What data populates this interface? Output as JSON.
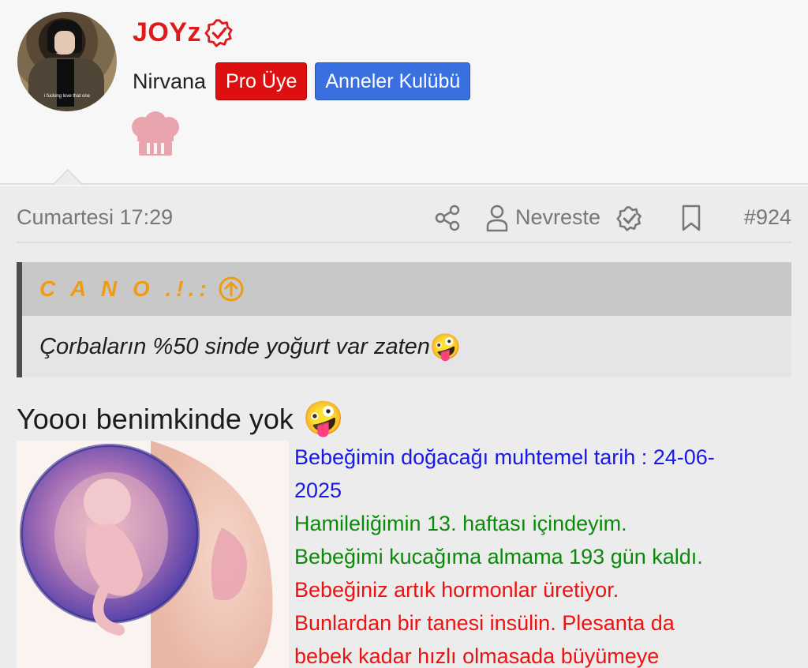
{
  "author": {
    "username": "JOYz",
    "title": "Nirvana",
    "avatar_caption": "i fucking love that one",
    "badges": [
      {
        "label": "Pro Üye",
        "color": "#dd0f10"
      },
      {
        "label": "Anneler Kulübü",
        "color": "#3a6fe0"
      }
    ],
    "verified_icon": "verified-badge-icon",
    "chef_icon": "chef-hat-icon",
    "accent_color": "#e01a1a"
  },
  "post": {
    "date": "Cumartesi 17:29",
    "mention": "Nevreste",
    "number": "#924",
    "icons": [
      "share-icon",
      "user-icon",
      "verified-badge-icon",
      "bookmark-icon"
    ]
  },
  "quote": {
    "author": "C A N O .!.:",
    "text": "Çorbaların %50 sinde yoğurt var zaten",
    "emoji": "🤪",
    "author_color": "#f09b16"
  },
  "reply": {
    "text": "Yoooı benimkinde yok",
    "emoji": "🤪"
  },
  "ticker": {
    "due_date_line": "Bebeğimin doğacağı muhtemel tarih : 24-06-",
    "due_date_year": "2025",
    "week_line": "Hamileliğimin 13. haftası içindeyim.",
    "days_line": "Bebeğimi kucağıma almama 193 gün kaldı.",
    "info_line1": "Bebeğiniz artık hormonlar üretiyor.",
    "info_line2": "Bunlardan bir tanesi insülin. Plesanta da",
    "info_line3": "bebek kadar hızlı olmasada büyümeye"
  }
}
